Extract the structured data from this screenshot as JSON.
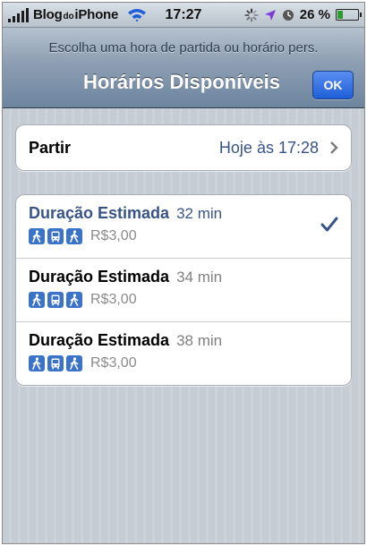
{
  "status_bar": {
    "carrier_left": "Blog",
    "carrier_middle": "do",
    "carrier_right": "iPhone",
    "time": "17:27",
    "battery_percent": "26 %",
    "battery_level": 0.26
  },
  "nav": {
    "prompt": "Escolha uma hora de partida ou horário pers.",
    "title": "Horários Disponíveis",
    "ok_label": "OK"
  },
  "departure": {
    "label": "Partir",
    "value": "Hoje às 17:28"
  },
  "routes": [
    {
      "title": "Duração Estimada",
      "duration": "32 min",
      "fare": "R$3,00",
      "selected": true,
      "modes": [
        "walk-icon",
        "bus-icon",
        "walk-icon"
      ]
    },
    {
      "title": "Duração Estimada",
      "duration": "34 min",
      "fare": "R$3,00",
      "selected": false,
      "modes": [
        "walk-icon",
        "bus-icon",
        "walk-icon"
      ]
    },
    {
      "title": "Duração Estimada",
      "duration": "38 min",
      "fare": "R$3,00",
      "selected": false,
      "modes": [
        "walk-icon",
        "bus-icon",
        "walk-icon"
      ]
    }
  ],
  "colors": {
    "accent_text": "#385487",
    "ok_button": "#2b6be0",
    "mode_icon": "#3b73c8"
  }
}
